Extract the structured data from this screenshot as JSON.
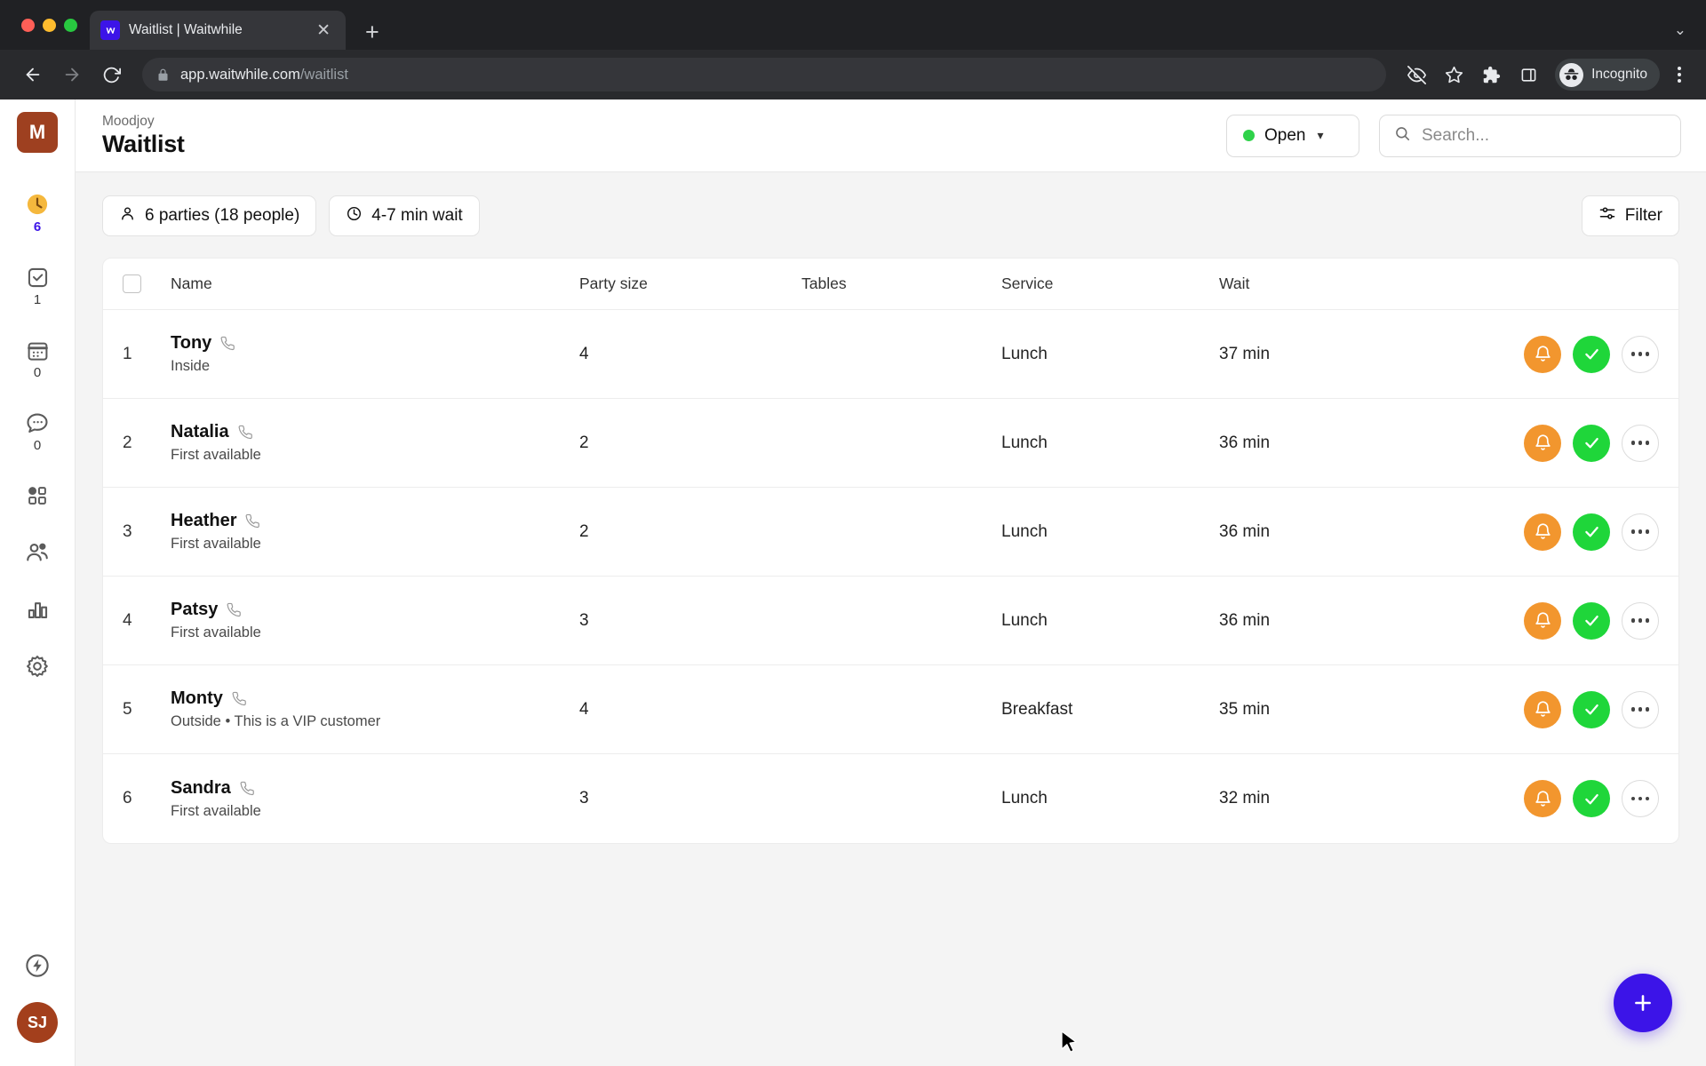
{
  "browser": {
    "tab": {
      "title": "Waitlist | Waitwhile",
      "favicon_letter": "W",
      "close_icon": "close-icon"
    },
    "new_tab_label": "+",
    "url": {
      "host": "app.waitwhile.com",
      "path": "/waitlist"
    },
    "incognito_label": "Incognito",
    "icons": [
      "back-arrow-icon",
      "forward-arrow-icon",
      "reload-icon",
      "lock-icon",
      "hide-password-icon",
      "bookmark-star-icon",
      "extensions-puzzle-icon",
      "side-panel-icon",
      "incognito-icon",
      "chrome-menu-icon"
    ]
  },
  "sidebar": {
    "org_initial": "M",
    "items": [
      {
        "name": "waitlist",
        "icon": "clock-icon",
        "count": "6",
        "active": true
      },
      {
        "name": "checkin",
        "icon": "check-square-icon",
        "count": "1",
        "active": false
      },
      {
        "name": "bookings",
        "icon": "calendar-icon",
        "count": "0",
        "active": false
      },
      {
        "name": "messages",
        "icon": "chat-bubble-icon",
        "count": "0",
        "active": false
      },
      {
        "name": "apps",
        "icon": "grid-icon",
        "count": "",
        "active": false
      },
      {
        "name": "customers",
        "icon": "people-icon",
        "count": "",
        "active": false
      },
      {
        "name": "analytics",
        "icon": "bar-chart-icon",
        "count": "",
        "active": false
      },
      {
        "name": "settings",
        "icon": "gear-icon",
        "count": "",
        "active": false
      }
    ],
    "bottom": {
      "power_icon": "lightning-bolt-icon",
      "user_initials": "SJ"
    }
  },
  "header": {
    "breadcrumb": "Moodjoy",
    "title": "Waitlist",
    "status_label": "Open",
    "status_color": "#2fd24a",
    "search_placeholder": "Search...",
    "search_value": ""
  },
  "toolbar": {
    "parties_label": "6 parties (18 people)",
    "wait_label": "4-7 min wait",
    "filter_label": "Filter"
  },
  "table": {
    "columns": [
      "Name",
      "Party size",
      "Tables",
      "Service",
      "Wait"
    ],
    "rows": [
      {
        "index": "1",
        "name": "Tony",
        "note": "Inside",
        "party": "4",
        "tables": "",
        "service": "Lunch",
        "wait": "37 min"
      },
      {
        "index": "2",
        "name": "Natalia",
        "note": "First available",
        "party": "2",
        "tables": "",
        "service": "Lunch",
        "wait": "36 min"
      },
      {
        "index": "3",
        "name": "Heather",
        "note": "First available",
        "party": "2",
        "tables": "",
        "service": "Lunch",
        "wait": "36 min"
      },
      {
        "index": "4",
        "name": "Patsy",
        "note": "First available",
        "party": "3",
        "tables": "",
        "service": "Lunch",
        "wait": "36 min"
      },
      {
        "index": "5",
        "name": "Monty",
        "note": "Outside  •  This is a VIP customer",
        "party": "4",
        "tables": "",
        "service": "Breakfast",
        "wait": "35 min"
      },
      {
        "index": "6",
        "name": "Sandra",
        "note": "First available",
        "party": "3",
        "tables": "",
        "service": "Lunch",
        "wait": "32 min"
      }
    ],
    "row_actions": {
      "notify_icon": "bell-icon",
      "serve_icon": "check-icon",
      "more_icon": "more-horizontal-icon"
    }
  },
  "fab": {
    "icon": "plus-icon",
    "color": "#3c14e8"
  },
  "colors": {
    "notify": "#f2962e",
    "serve": "#1fd63a",
    "accent": "#3c14e8",
    "org": "#9e4020"
  }
}
